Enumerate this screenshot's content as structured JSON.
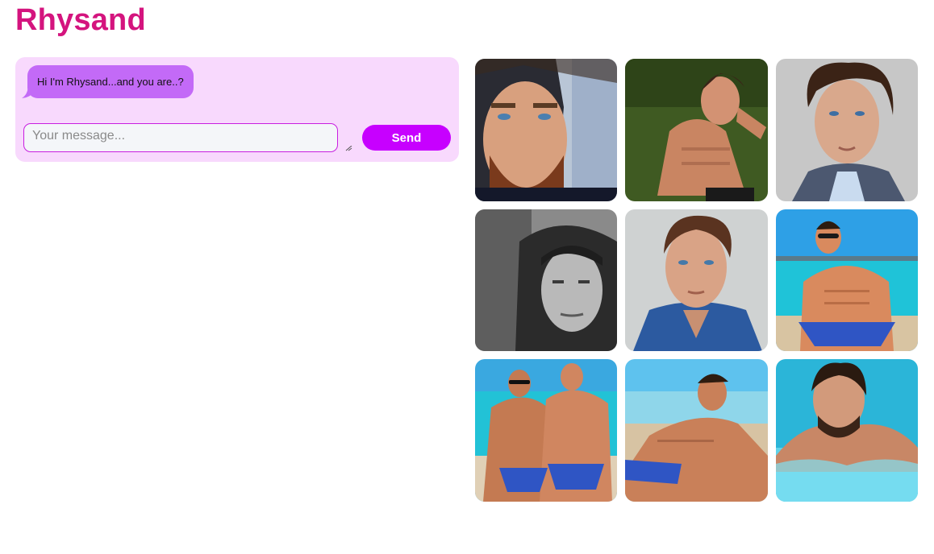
{
  "header": {
    "title": "Rhysand"
  },
  "chat": {
    "messages": [
      {
        "from": "bot",
        "text": "Hi I'm Rhysand...and you are..?"
      }
    ],
    "input": {
      "placeholder": "Your message...",
      "value": ""
    },
    "send_label": "Send"
  },
  "theme": {
    "title_color": "#d4147e",
    "panel_bg": "#f8d9fd",
    "bubble_bg": "#c36af7",
    "button_bg": "#c700ff"
  },
  "gallery": {
    "photos": [
      {
        "name": "bearded-man-portrait"
      },
      {
        "name": "shirtless-man-on-grass"
      },
      {
        "name": "curly-hair-man-in-vest"
      },
      {
        "name": "hooded-man-black-white"
      },
      {
        "name": "man-in-denim-shirt"
      },
      {
        "name": "man-with-sunglasses-at-beach"
      },
      {
        "name": "two-men-at-beach"
      },
      {
        "name": "man-lying-on-beach"
      },
      {
        "name": "man-in-pool"
      }
    ]
  }
}
